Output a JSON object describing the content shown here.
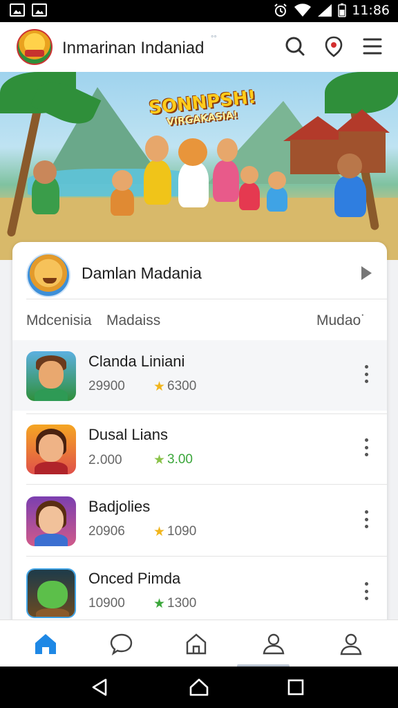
{
  "status_bar": {
    "time": "11:86"
  },
  "app_bar": {
    "title": "Inmarinan Indaniad",
    "title_mark": "°°"
  },
  "hero": {
    "title_line1": "SONNPSH!",
    "title_line2": "VIRGAKASIA!"
  },
  "featured": {
    "name": "Damlan Madania"
  },
  "tabs": [
    "Mdcenisia",
    "Madaiss",
    "Mudao˙"
  ],
  "games": [
    {
      "title": "Clanda Liniani",
      "count": "29900",
      "rating": "6300",
      "star_color": "#f1b51c",
      "rating_color": "#666666"
    },
    {
      "title": "Dusal Lians",
      "count": "2․000",
      "rating": "3.00",
      "star_color": "#8bc34a",
      "rating_color": "#3aa63a"
    },
    {
      "title": "Badjolies",
      "count": "20906",
      "rating": "1090",
      "star_color": "#f1b51c",
      "rating_color": "#666666"
    },
    {
      "title": "Onced Pimda",
      "count": "10900",
      "rating": "1300",
      "star_color": "#3aa63a",
      "rating_color": "#666666"
    }
  ],
  "icons": {
    "search": "search-icon",
    "notification": "notification-icon",
    "menu": "menu-icon",
    "nav": [
      "home-icon",
      "chat-icon",
      "house-icon",
      "community-icon",
      "profile-icon"
    ],
    "system": [
      "back-icon",
      "home-button-icon",
      "recents-icon"
    ]
  },
  "colors": {
    "accent": "#1e88e5",
    "star": "#f1b51c"
  }
}
